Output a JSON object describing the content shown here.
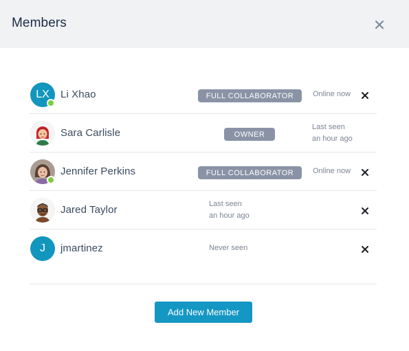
{
  "dialog": {
    "title": "Members",
    "close_icon": "close-icon"
  },
  "members": [
    {
      "initials": "LX",
      "name": "Li Xhao",
      "role": "FULL COLLABORATOR",
      "status_line1": "Online now",
      "status_line2": "",
      "online": true,
      "avatar": "initials",
      "removable": true
    },
    {
      "initials": "",
      "name": "Sara Carlisle",
      "role": "OWNER",
      "status_line1": "Last seen",
      "status_line2": "an hour ago",
      "online": false,
      "avatar": "photo-red-hair-woman",
      "removable": false
    },
    {
      "initials": "",
      "name": "Jennifer Perkins",
      "role": "FULL COLLABORATOR",
      "status_line1": "Online now",
      "status_line2": "",
      "online": true,
      "avatar": "photo-woman",
      "removable": true
    },
    {
      "initials": "",
      "name": "Jared Taylor",
      "role": "",
      "status_line1": "Last seen",
      "status_line2": "an hour ago",
      "online": false,
      "avatar": "photo-man-glasses",
      "removable": true
    },
    {
      "initials": "J",
      "name": "jmartinez",
      "role": "",
      "status_line1": "Never seen",
      "status_line2": "",
      "online": false,
      "avatar": "initials",
      "removable": true
    }
  ],
  "actions": {
    "add_member_label": "Add New Member"
  },
  "colors": {
    "header_bg": "#f0f2f4",
    "accent": "#1597c4",
    "badge": "#8a93a6",
    "online": "#7ccf3c"
  }
}
